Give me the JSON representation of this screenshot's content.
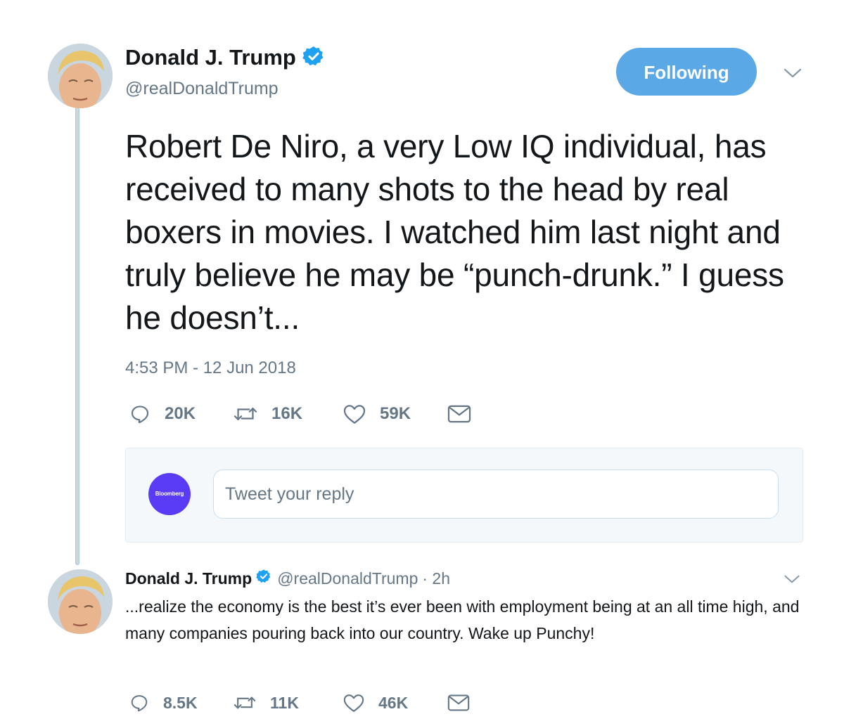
{
  "main_tweet": {
    "author": {
      "name": "Donald J. Trump",
      "handle": "@realDonaldTrump"
    },
    "follow_button": "Following",
    "text": "Robert De Niro, a very Low IQ individual, has received to many shots to the head by real boxers in movies. I watched him last night and truly believe he may be “punch-drunk.” I guess he doesn’t...",
    "timestamp": "4:53 PM - 12 Jun 2018",
    "actions": {
      "replies": "20K",
      "retweets": "16K",
      "likes": "59K"
    }
  },
  "reply_box": {
    "avatar_label": "Bloomberg",
    "placeholder": "Tweet your reply"
  },
  "second_tweet": {
    "author": {
      "name": "Donald J. Trump",
      "handle": "@realDonaldTrump",
      "time": "· 2h"
    },
    "text": "...realize the economy is the best it’s ever been with employment being at an all time high, and many companies pouring back into our country. Wake up Punchy!",
    "actions": {
      "replies": "8.5K",
      "retweets": "11K",
      "likes": "46K"
    }
  },
  "colors": {
    "accent": "#1da1f2",
    "follow_button": "#5aa8e6",
    "secondary_text": "#657786",
    "reply_avatar": "#5b3cf6"
  },
  "icons": [
    "verified-badge-icon",
    "chevron-down-icon",
    "reply-icon",
    "retweet-icon",
    "like-icon",
    "direct-message-icon"
  ]
}
